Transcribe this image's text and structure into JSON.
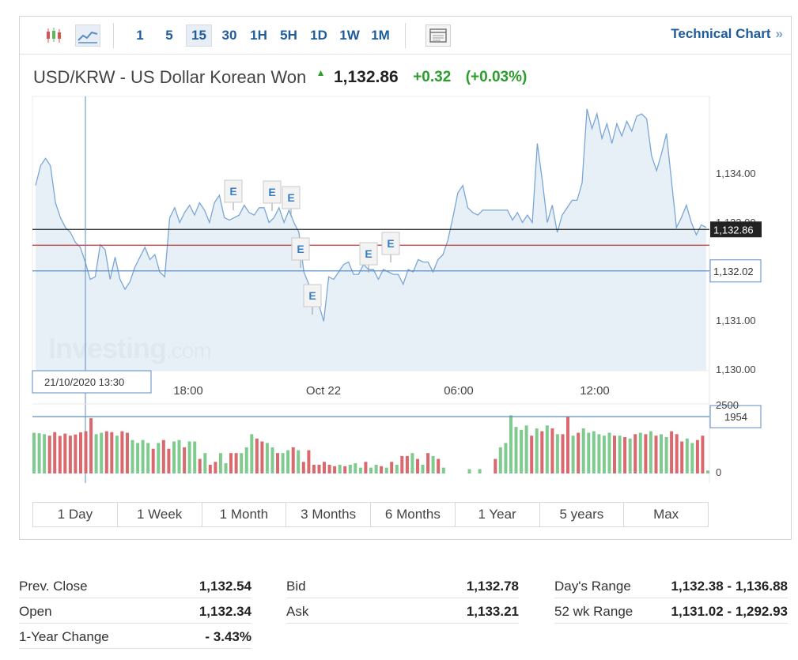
{
  "toolbar": {
    "intervals": [
      "1",
      "5",
      "15",
      "30",
      "1H",
      "5H",
      "1D",
      "1W",
      "1M"
    ],
    "selected_interval": "15",
    "technical_chart_label": "Technical Chart",
    "technical_chart_arrow": "»",
    "icons": [
      "candlestick-icon",
      "line-chart-icon",
      "chart-window-icon"
    ]
  },
  "header": {
    "pair": "USD/KRW - US Dollar Korean Won",
    "price": "1,132.86",
    "change": "+0.32",
    "change_pct": "(+0.03%)",
    "up_color": "#2a9d2a"
  },
  "chart_data": {
    "type": "area",
    "x_tick_labels": [
      "18:00",
      "Oct 22",
      "06:00",
      "12:00"
    ],
    "y_tick_labels": [
      "1,134.00",
      "1,133.00",
      "1,132.86",
      "1,132.02",
      "1,131.00",
      "1,130.00"
    ],
    "ylim": [
      1130.0,
      1135.6
    ],
    "current_price": 1132.86,
    "current_price_label": "1,132.86",
    "prev_close": 1132.54,
    "crosshair": {
      "label": "21/10/2020 13:30",
      "value": 1132.02,
      "value_label": "1,132.02"
    },
    "series": [
      {
        "values": [
          1133.75,
          1134.15,
          1134.3,
          1134.15,
          1133.4,
          1133.1,
          1132.9,
          1132.8,
          1132.6,
          1132.5,
          1132.2,
          1131.85,
          1131.9,
          1132.55,
          1132.45,
          1131.85,
          1132.3,
          1131.85,
          1131.65,
          1131.8,
          1132.1,
          1132.3,
          1132.5,
          1132.25,
          1132.35,
          1132.0,
          1131.9,
          1133.1,
          1133.3,
          1133.0,
          1133.2,
          1133.35,
          1133.15,
          1133.4,
          1133.25,
          1133.0,
          1133.4,
          1133.55,
          1133.1,
          1133.05,
          1133.1,
          1133.15,
          1133.35,
          1133.2,
          1133.15,
          1133.3,
          1133.3,
          1133.0,
          1133.1,
          1133.3,
          1133.0,
          1133.25,
          1133.0,
          1132.8,
          1132.0,
          1131.75,
          1131.55,
          1131.35,
          1131.0,
          1131.9,
          1131.85,
          1132.0,
          1132.15,
          1132.2,
          1131.95,
          1131.95,
          1132.15,
          1132.05,
          1132.05,
          1131.85,
          1132.05,
          1132.0,
          1131.95,
          1131.95,
          1131.75,
          1132.05,
          1132.0,
          1132.25,
          1132.2,
          1132.2,
          1132.0,
          1132.25,
          1132.35,
          1132.65,
          1133.1,
          1133.6,
          1133.75,
          1133.3,
          1133.2,
          1133.15,
          1133.25,
          1133.25,
          1133.25,
          1133.25,
          1133.25,
          1133.25,
          1133.05,
          1133.2,
          1133.0,
          1133.15,
          1133.0,
          1134.6,
          1133.85,
          1133.0,
          1133.35,
          1132.8,
          1133.15,
          1133.3,
          1133.45,
          1133.45,
          1133.8,
          1135.3,
          1134.9,
          1135.2,
          1134.7,
          1135.0,
          1134.6,
          1135.0,
          1134.75,
          1135.05,
          1134.85,
          1135.15,
          1135.2,
          1135.1,
          1134.35,
          1134.05,
          1134.4,
          1134.8,
          1133.85,
          1132.9,
          1133.1,
          1133.35,
          1133.0,
          1132.75,
          1132.95,
          1132.9
        ]
      }
    ],
    "volume": {
      "ylim": [
        0,
        2500
      ],
      "tick_labels": [
        "2500",
        "0"
      ],
      "crosshair_value": 1954,
      "crosshair_label": "1954",
      "values": [
        1400,
        1380,
        1350,
        1300,
        1420,
        1290,
        1370,
        1300,
        1340,
        1410,
        1450,
        1900,
        1350,
        1400,
        1450,
        1420,
        1300,
        1450,
        1400,
        1150,
        1050,
        1150,
        1050,
        850,
        1050,
        1150,
        850,
        1100,
        1150,
        900,
        1100,
        1100,
        500,
        700,
        300,
        400,
        700,
        350,
        700,
        700,
        700,
        900,
        1350,
        1200,
        1100,
        1050,
        900,
        700,
        700,
        800,
        900,
        800,
        400,
        800,
        300,
        300,
        400,
        300,
        250,
        300,
        250,
        300,
        350,
        200,
        400,
        200,
        300,
        250,
        200,
        400,
        300,
        600,
        600,
        700,
        500,
        300,
        700,
        600,
        500,
        200,
        0,
        0,
        0,
        0,
        150,
        0,
        150,
        0,
        0,
        500,
        900,
        1050,
        2000,
        1600,
        1500,
        1650,
        1300,
        1550,
        1450,
        1650,
        1550,
        1350,
        1350,
        1950,
        1300,
        1400,
        1550,
        1400,
        1450,
        1350,
        1300,
        1400,
        1300,
        1300,
        1250,
        1200,
        1350,
        1400,
        1350,
        1450,
        1300,
        1350,
        1250,
        1450,
        1350,
        1100,
        1200,
        1050,
        1150,
        1300,
        100
      ],
      "up_color": "#7fcb8f",
      "down_color": "#d9696e"
    },
    "watermark": "Investing.com",
    "event_marker_label": "E",
    "colors": {
      "line": "#7aa6d6",
      "fill": "#e4edf6",
      "current_line": "#222222",
      "prev_close_line": "#c8383b",
      "crosshair": "#5b8bc3"
    }
  },
  "ranges": [
    "1 Day",
    "1 Week",
    "1 Month",
    "3 Months",
    "6 Months",
    "1 Year",
    "5 years",
    "Max"
  ],
  "stats": {
    "prev_close": {
      "label": "Prev. Close",
      "value": "1,132.54"
    },
    "open": {
      "label": "Open",
      "value": "1,132.34"
    },
    "one_year_change": {
      "label": "1-Year Change",
      "value": "- 3.43%"
    },
    "bid": {
      "label": "Bid",
      "value": "1,132.78"
    },
    "ask": {
      "label": "Ask",
      "value": "1,133.21"
    },
    "days_range": {
      "label": "Day's Range",
      "value": "1,132.38 - 1,136.88"
    },
    "wk52_range": {
      "label": "52 wk Range",
      "value": "1,131.02 - 1,292.93"
    }
  }
}
